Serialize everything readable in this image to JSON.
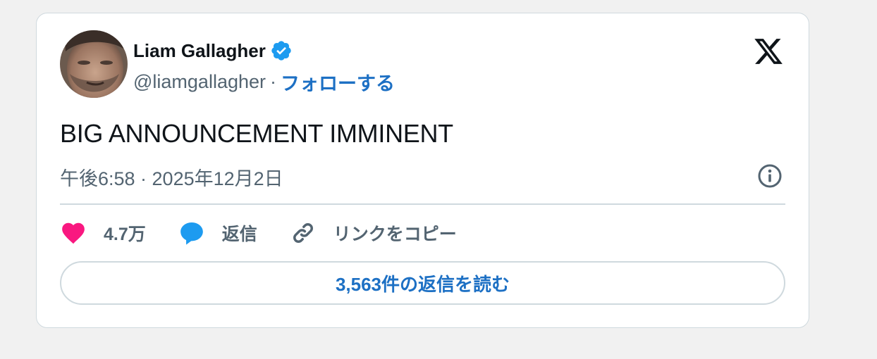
{
  "author": {
    "name": "Liam Gallagher",
    "handle": "@liamgallagher",
    "separator": "·",
    "follow_label": "フォローする",
    "verified": true,
    "verified_icon": "verified-badge-icon",
    "avatar_icon": "avatar-photo"
  },
  "tweet": {
    "text": "BIG ANNOUNCEMENT IMMINENT",
    "timestamp": "午後6:58 · 2025年12月2日"
  },
  "actions": {
    "likes_label": "4.7万",
    "reply_label": "返信",
    "copy_link_label": "リンクをコピー"
  },
  "read_replies_label": "3,563件の返信を読む",
  "icons": [
    "x-logo-icon",
    "info-icon",
    "heart-icon",
    "reply-bubble-icon",
    "link-icon"
  ],
  "colors": {
    "accent_blue": "#1d70c4",
    "verified_blue": "#1d9bf0",
    "heart_pink": "#f91880",
    "text_primary": "#0f1419",
    "text_secondary": "#536471",
    "border": "#cfd9de",
    "background": "#f1f1f1"
  }
}
